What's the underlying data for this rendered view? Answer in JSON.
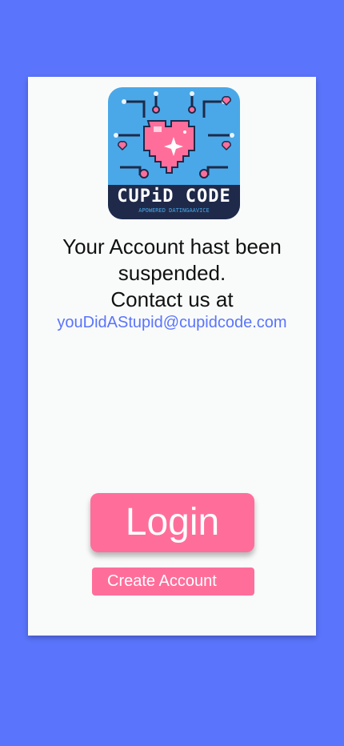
{
  "logo": {
    "icon": "pixel-heart-circuit-icon",
    "title": "CUPiD CODE",
    "tagline": "APOWERED DATINGAAVICE",
    "colors": {
      "background": "#4aa8e8",
      "heart": "#ff6e9b",
      "dark": "#1f2a4a"
    }
  },
  "message": {
    "line1": "Your Account hast been",
    "line2": "suspended.",
    "line3": "Contact us at"
  },
  "contact_email": "youDidAStupid@cupidcode.com",
  "buttons": {
    "login_label": "Login",
    "create_account_label": "Create Account"
  },
  "colors": {
    "page_background": "#5a74fb",
    "card_background": "#f9fbfb",
    "accent": "#ff6e9b",
    "link": "#5a74fb"
  }
}
